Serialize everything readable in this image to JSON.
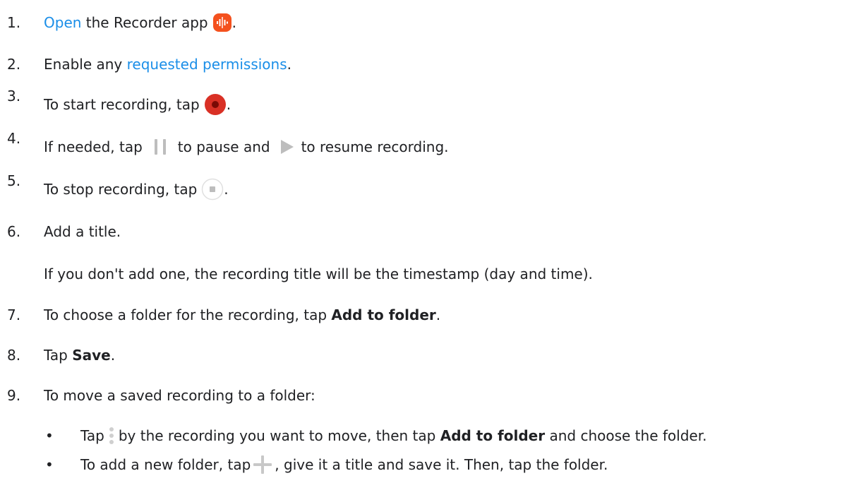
{
  "steps": [
    {
      "num": "1.",
      "link": "Open",
      "text": "the Recorder app",
      "end": "."
    },
    {
      "num": "2.",
      "pre": "Enable any",
      "link": "requested permissions",
      "end": "."
    },
    {
      "num": "3.",
      "text": "To start recording, tap",
      "end": "."
    },
    {
      "num": "4.",
      "pre": "If needed, tap",
      "mid": "to pause and",
      "post": "to resume recording."
    },
    {
      "num": "5.",
      "text": "To stop recording, tap",
      "end": "."
    },
    {
      "num": "6.",
      "text": "Add a title.",
      "sub": "If you don't add one, the recording title will be the timestamp (day and time)."
    },
    {
      "num": "7.",
      "pre": "To choose a folder for the recording, tap",
      "bold": "Add to folder",
      "end": "."
    },
    {
      "num": "8.",
      "pre": "Tap",
      "bold": "Save",
      "end": "."
    },
    {
      "num": "9.",
      "text": "To move a saved recording to a folder:"
    }
  ],
  "bullets": [
    {
      "mark": "•",
      "pre": "Tap",
      "mid": "by the recording you want to move, then tap",
      "bold": "Add to folder",
      "post": "and choose the folder."
    },
    {
      "mark": "•",
      "pre": "To add a new folder, tap",
      "post": ", give it a title and save it. Then, tap the folder."
    }
  ],
  "colors": {
    "link": "#1a8ee8",
    "record_red": "#d93025",
    "app_icon": "#f4511e",
    "control_gray": "#bdbdbd"
  },
  "icons": [
    "recorder-app-icon",
    "record-icon",
    "pause-icon",
    "play-icon",
    "stop-icon",
    "more-vert-icon",
    "plus-icon"
  ]
}
